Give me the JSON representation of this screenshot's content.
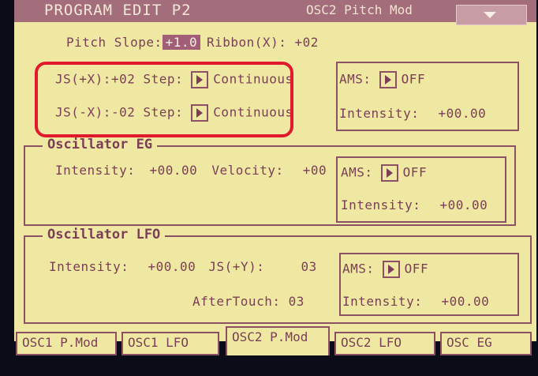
{
  "header": {
    "title": "PROGRAM EDIT P2",
    "section_tag": "OSC2 Pitch Mod",
    "dropdown_icon": "down-triangle-icon"
  },
  "pitch_slope": {
    "label": "Pitch Slope:",
    "value": "+1.0"
  },
  "ribbon": {
    "label": "Ribbon(X):",
    "value": "+02"
  },
  "js_plus_x": {
    "label": "JS(+X):",
    "value": "+02",
    "step_label": "Step:",
    "step_value": "Continuous"
  },
  "js_minus_x": {
    "label": "JS(-X):",
    "value": "-02",
    "step_label": "Step:",
    "step_value": "Continuous"
  },
  "ams_top": {
    "label": "AMS:",
    "value": "OFF",
    "intensity_label": "Intensity:",
    "intensity_value": "+00.00"
  },
  "osc_eg": {
    "title": "Oscillator EG",
    "intensity_label": "Intensity:",
    "intensity_value": "+00.00",
    "velocity_label": "Velocity:",
    "velocity_value": "+00",
    "ams_label": "AMS:",
    "ams_value": "OFF",
    "ams_intensity_label": "Intensity:",
    "ams_intensity_value": "+00.00"
  },
  "osc_lfo": {
    "title": "Oscillator LFO",
    "intensity_label": "Intensity:",
    "intensity_value": "+00.00",
    "js_label": "JS(+Y):",
    "js_value": "03",
    "aftertouch_label": "AfterTouch:",
    "aftertouch_value": "03",
    "ams_label": "AMS:",
    "ams_value": "OFF",
    "ams_intensity_label": "Intensity:",
    "ams_intensity_value": "+00.00"
  },
  "tabs": [
    {
      "label": "OSC1 P.Mod"
    },
    {
      "label": "OSC1 LFO"
    },
    {
      "label": "OSC2 P.Mod"
    },
    {
      "label": "OSC2 LFO"
    },
    {
      "label": "OSC EG"
    }
  ],
  "colors": {
    "screen_bg": "#efe8a2",
    "text": "#7a3e56",
    "highlight": "#a35e77",
    "annotation": "#e0192c"
  }
}
